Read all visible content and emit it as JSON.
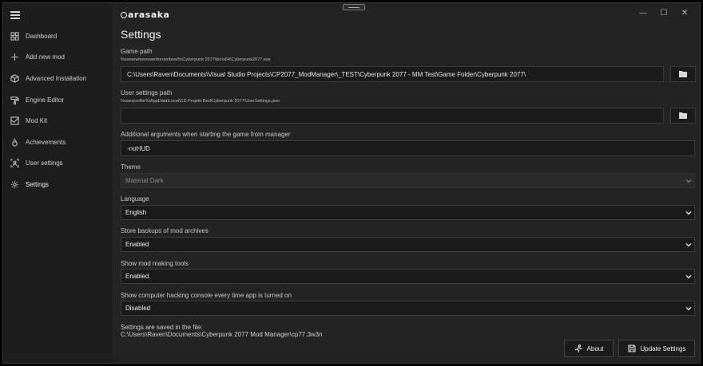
{
  "app": {
    "logo_text": "arasaka"
  },
  "window_controls": {
    "minimize": "—",
    "maximize": "☐",
    "close": "✕"
  },
  "sidebar": {
    "items": [
      {
        "label": "Dashboard",
        "icon": "dashboard-icon"
      },
      {
        "label": "Add new mod",
        "icon": "plus-icon"
      },
      {
        "label": "Advanced Installation",
        "icon": "package-icon"
      },
      {
        "label": "Engine Editor",
        "icon": "paint-icon"
      },
      {
        "label": "Mod Kit",
        "icon": "toolkit-icon"
      },
      {
        "label": "Achievements",
        "icon": "flame-icon"
      },
      {
        "label": "User settings",
        "icon": "user-frame-icon"
      },
      {
        "label": "Settings",
        "icon": "gear-icon"
      }
    ],
    "active_index": 7
  },
  "page": {
    "title": "Settings"
  },
  "settings": {
    "game_path": {
      "label": "Game path",
      "hint": "%somewhereovertherainbow%\\Cyberpunk 2077\\bin\\x64\\Cyberpunk2077.exe",
      "value": "C:\\Users\\Raven\\Documents\\Visual Studio Projects\\CP2077_ModManager\\_TEST\\Cyberpunk 2077 - MM Test\\Game Folder\\Cyberpunk 2077\\"
    },
    "user_settings_path": {
      "label": "User settings path",
      "hint": "%userprofile%\\AppData\\Local\\CD Projekt Red\\Cyberpunk 2077\\UserSettings.json",
      "value": ""
    },
    "additional_args": {
      "label": "Additional arguments when starting the game from manager",
      "value": "-noHUD"
    },
    "theme": {
      "label": "Theme",
      "value": "Material Dark"
    },
    "language": {
      "label": "Language",
      "value": "English"
    },
    "store_backups": {
      "label": "Store backups of mod archives",
      "value": "Enabled"
    },
    "mod_tools": {
      "label": "Show mod making tools",
      "value": "Enabled"
    },
    "hacking_console": {
      "label": "Show computer hacking console every time app is turned on",
      "value": "Disabled"
    }
  },
  "footer": {
    "saved_label": "Settings are saved in the file:",
    "saved_path": "C:\\Users\\Raven\\Documents\\Cyberpunk 2077 Mod Manager\\cp77.3w3n",
    "about_label": "About",
    "update_label": "Update Settings"
  }
}
